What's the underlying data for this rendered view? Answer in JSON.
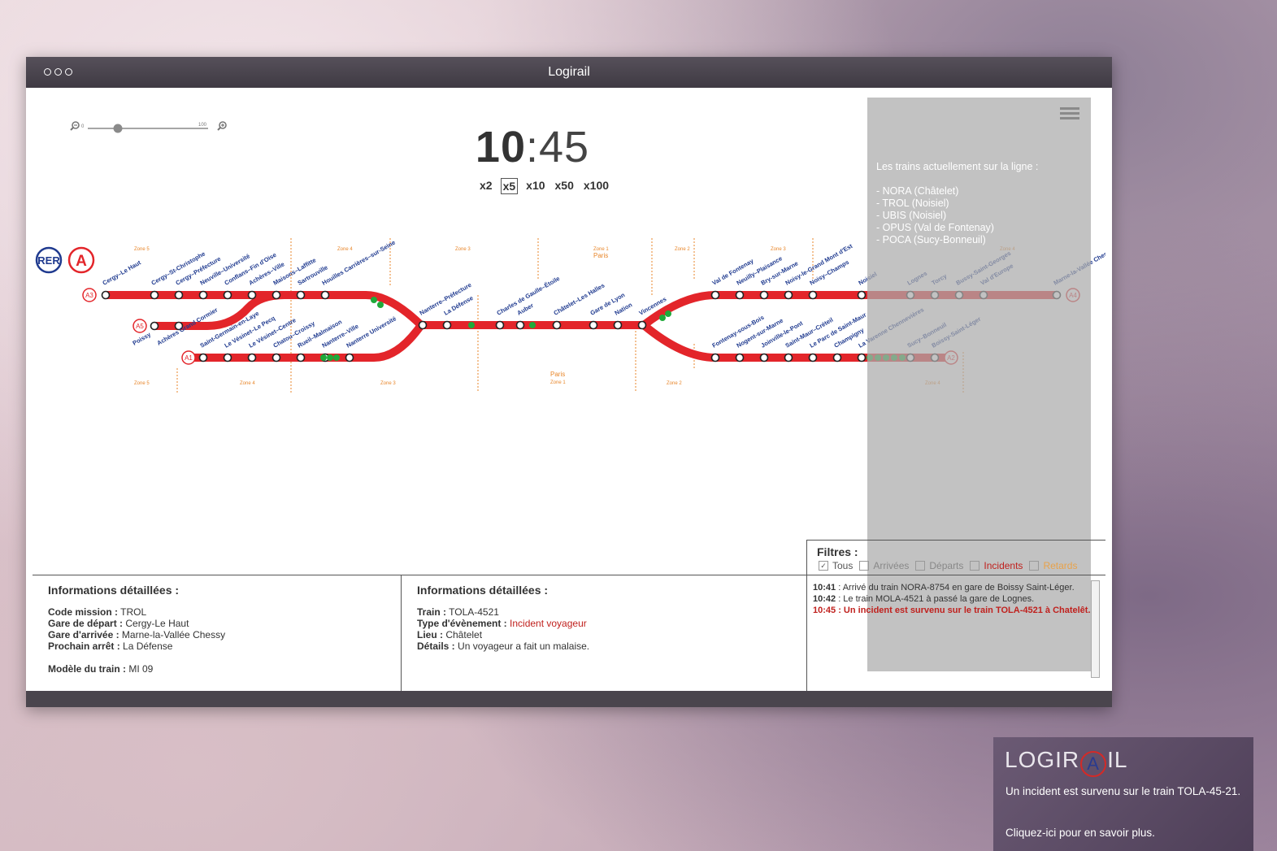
{
  "window": {
    "title": "Logirail"
  },
  "zoom": {
    "min_label": "0",
    "max_label": "100",
    "value": 0.25
  },
  "clock": {
    "hours": "10",
    "sep_minutes": ":45"
  },
  "speeds": [
    {
      "label": "x2",
      "selected": false
    },
    {
      "label": "x5",
      "selected": true
    },
    {
      "label": "x10",
      "selected": false
    },
    {
      "label": "x50",
      "selected": false
    },
    {
      "label": "x100",
      "selected": false
    }
  ],
  "map": {
    "badges": {
      "rer": "RER",
      "line": "A"
    },
    "branches": [
      "A3",
      "A5",
      "A1",
      "A4",
      "A2"
    ],
    "zones": [
      "Zone 5",
      "Zone 4",
      "Zone 3",
      "Zone 1",
      "Paris",
      "Zone 2",
      "Zone 3",
      "Zone 4",
      "Zone 5",
      "Zone 4",
      "Zone 3",
      "Paris",
      "Zone 1",
      "Zone 2",
      "Zone 4"
    ],
    "stations": {
      "a3_top": [
        "Cergy–Le Haut",
        "Cergy–St-Christophe",
        "Cergy–Préfecture",
        "Neuville–Université",
        "Conflans–Fin d'Oise",
        "Achères–Ville",
        "Maisons–Laffitte",
        "Sartrouville",
        "Houilles Carrières–sur-Seine"
      ],
      "a5": [
        "Poissy",
        "Achères Grand Cormier"
      ],
      "a1": [
        "Saint-Germain-en-Laye",
        "Le Vésinet–Le Pecq",
        "Le Vésinet–Centre",
        "Chatou–Croissy",
        "Rueil–Malmaison",
        "Nanterre–Ville",
        "Nanterre Université"
      ],
      "central": [
        "Nanterre–Préfecture",
        "La Défense",
        "Charles de Gaulle–Étoile",
        "Auber",
        "Châtelet–Les Halles",
        "Gare de Lyon",
        "Nation",
        "Vincennes"
      ],
      "a4": [
        "Val de Fontenay",
        "Neuilly–Plaisance",
        "Bry-sur-Marne",
        "Noisy-le-Grand Mont d'Est",
        "Noisy–Champs",
        "Noisiel",
        "Lognes",
        "Torcy",
        "Bussy-Saint-Georges",
        "Val d'Europe",
        "Marne-la-Vallée Chessy"
      ],
      "a2": [
        "Fontenay-sous-Bois",
        "Nogent-sur-Marne",
        "Joinville-le-Pont",
        "Saint-Maur–Créteil",
        "Le Parc de Saint-Maur",
        "Champigny",
        "La Varenne Chennevières",
        "Sucy–Bonneuil",
        "Boissy-Saint-Léger"
      ]
    },
    "colors": {
      "line": "#e3252a",
      "train": "#1faa3a",
      "label": "#1f3a8f",
      "zone": "#e8862a"
    }
  },
  "trains_panel": {
    "heading": "Les trains actuellement sur la ligne :",
    "items": [
      "- NORA (Châtelet)",
      "- TROL (Noisiel)",
      "- UBIS (Noisiel)",
      "- OPUS (Val de Fontenay)",
      "- POCA (Sucy-Bonneuil)"
    ]
  },
  "filters": {
    "title": "Filtres :",
    "items": [
      {
        "label": "Tous",
        "checked": true,
        "color": "#555555"
      },
      {
        "label": "Arrivées",
        "checked": false,
        "color": "#888888"
      },
      {
        "label": "Départs",
        "checked": false,
        "color": "#888888"
      },
      {
        "label": "Incidents",
        "checked": false,
        "color": "#c0211e"
      },
      {
        "label": "Retards",
        "checked": false,
        "color": "#e8a24a"
      }
    ]
  },
  "details_train": {
    "title": "Informations détaillées :",
    "mission_label": "Code mission :",
    "mission": "TROL",
    "depart_label": "Gare de départ :",
    "depart": "Cergy-Le Haut",
    "arrival_label": "Gare d'arrivée :",
    "arrival": "Marne-la-Vallée Chessy",
    "next_label": "Prochain arrêt :",
    "next": "La Défense",
    "model_label": "Modèle du train :",
    "model": "MI 09"
  },
  "details_event": {
    "title": "Informations détaillées :",
    "train_label": "Train :",
    "train": "TOLA-4521",
    "type_label": "Type d'évènement :",
    "type": "Incident voyageur",
    "place_label": "Lieu :",
    "place": "Châtelet",
    "details_label": "Détails :",
    "details": "Un voyageur a fait un malaise."
  },
  "log": [
    {
      "time": "10:41",
      "text": " : Arrivé du train NORA-8754 en gare de Boissy Saint-Léger."
    },
    {
      "time": "10:42",
      "text": " : Le train MOLA-4521 à passé la gare de Lognes."
    },
    {
      "time": "10:45",
      "text": " : Un incident est survenu sur le train TOLA-4521 à Chatelêt."
    }
  ],
  "toast": {
    "logo_left": "LOGIR",
    "logo_ring": "A",
    "logo_right": "IL",
    "message": "Un incident est survenu sur le train TOLA-45-21.",
    "more": "Cliquez-ici pour en savoir plus."
  }
}
